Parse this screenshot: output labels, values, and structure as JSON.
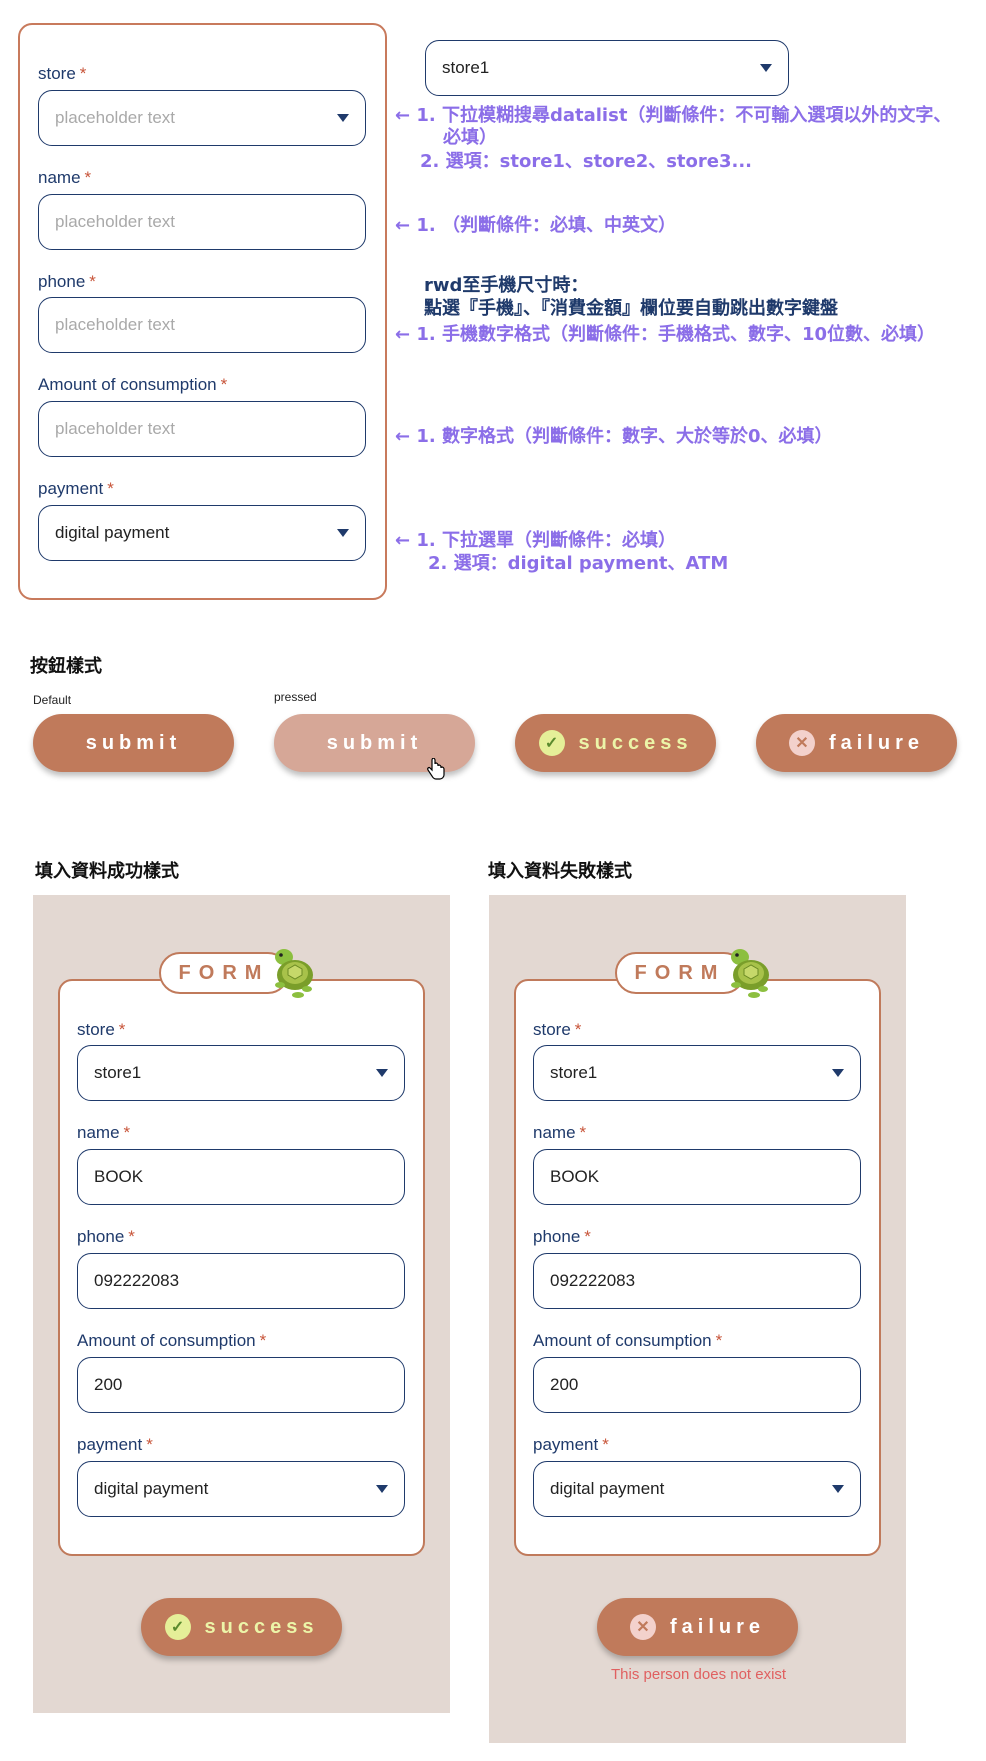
{
  "main_form": {
    "fields": [
      {
        "label": "store",
        "required": "*",
        "value": "placeholder text",
        "type": "select"
      },
      {
        "label": "name",
        "required": "*",
        "value": "placeholder text",
        "type": "input"
      },
      {
        "label": "phone",
        "required": "*",
        "value": "placeholder text",
        "type": "input"
      },
      {
        "label": "Amount of consumption",
        "required": "*",
        "value": "placeholder text",
        "type": "input"
      },
      {
        "label": "payment",
        "required": "*",
        "value": "digital payment",
        "type": "select"
      }
    ]
  },
  "datalist_example": {
    "value": "store1"
  },
  "annotations": {
    "store_line1": "← 1. 下拉模糊搜尋datalist（判斷條件：不可輸入選項以外的文字、",
    "store_line2": "必填）",
    "store_line3": "2. 選項：store1、store2、store3...",
    "name_line1": "← 1. （判斷條件：必填、中英文）",
    "rwd_line1": "rwd至手機尺寸時：",
    "rwd_line2": "點選『手機』、『消費金額』欄位要自動跳出數字鍵盤",
    "phone_line1": "← 1. 手機數字格式（判斷條件：手機格式、數字、10位數、必填）",
    "amount_line1": "← 1. 數字格式（判斷條件：數字、大於等於0、必填）",
    "payment_line1": "←  1. 下拉選單（判斷條件：必填）",
    "payment_line2": "2. 選項：digital payment、ATM"
  },
  "buttons_section": {
    "title": "按鈕樣式",
    "default_label": "Default",
    "pressed_label": "pressed",
    "submit": "submit",
    "success": "success",
    "failure": "failure"
  },
  "success_panel": {
    "title": "填入資料成功樣式",
    "form_badge": "FORM",
    "fields": [
      {
        "label": "store",
        "required": "*",
        "value": "store1"
      },
      {
        "label": "name",
        "required": "*",
        "value": "BOOK"
      },
      {
        "label": "phone",
        "required": "*",
        "value": "092222083"
      },
      {
        "label": "Amount of consumption",
        "required": "*",
        "value": "200"
      },
      {
        "label": "payment",
        "required": "*",
        "value": "digital payment"
      }
    ],
    "button": "success"
  },
  "failure_panel": {
    "title": "填入資料失敗樣式",
    "form_badge": "FORM",
    "fields": [
      {
        "label": "store",
        "required": "*",
        "value": "store1"
      },
      {
        "label": "name",
        "required": "*",
        "value": "BOOK"
      },
      {
        "label": "phone",
        "required": "*",
        "value": "092222083"
      },
      {
        "label": "Amount of consumption",
        "required": "*",
        "value": "200"
      },
      {
        "label": "payment",
        "required": "*",
        "value": "digital payment"
      }
    ],
    "button": "failure",
    "error": "This person does not exist"
  },
  "icons": {
    "caret": "chevron-down-icon",
    "success": "check-circle-icon",
    "failure": "x-circle-icon",
    "turtle": "turtle-icon",
    "cursor": "hand-pointer-icon"
  },
  "colors": {
    "accent": "#c07a5b",
    "pressed": "#d6a797",
    "navy": "#1f3a6b",
    "annotation": "#8b6ee8",
    "panel_bg": "#e3d8d2",
    "success_icon": "#e5ef98",
    "error_text": "#e06060"
  }
}
